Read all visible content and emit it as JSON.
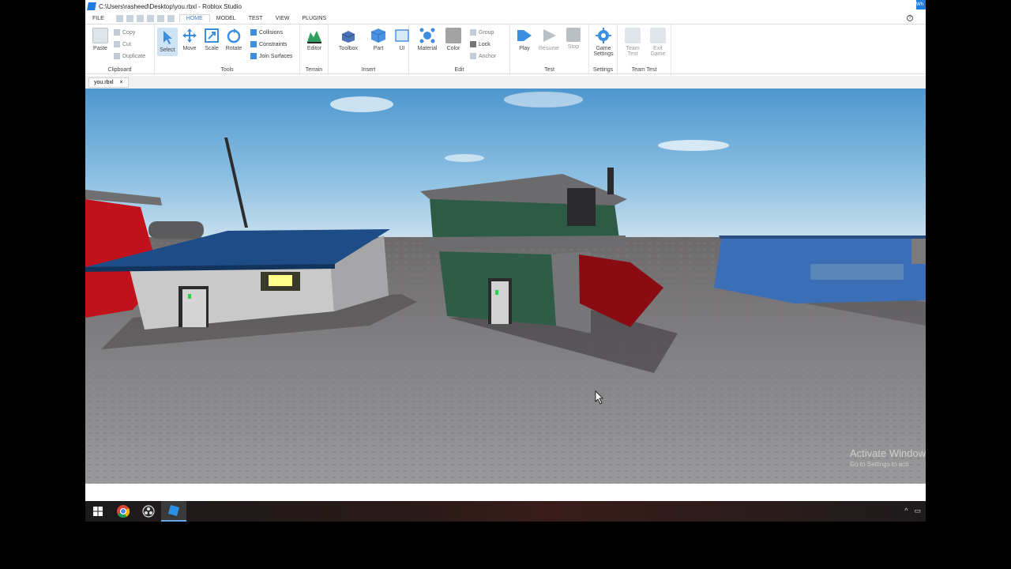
{
  "window": {
    "title": "C:\\Users\\rasheed\\Desktop\\you.rbxl - Roblox Studio",
    "edge_label": "Wh"
  },
  "menu": {
    "file": "FILE",
    "tabs": [
      "HOME",
      "MODEL",
      "TEST",
      "VIEW",
      "PLUGINS"
    ],
    "active_tab": "HOME"
  },
  "ribbon": {
    "clipboard": {
      "paste": "Paste",
      "copy": "Copy",
      "cut": "Cut",
      "duplicate": "Duplicate",
      "label": "Clipboard"
    },
    "tools": {
      "select": "Select",
      "move": "Move",
      "scale": "Scale",
      "rotate": "Rotate",
      "collisions": "Collisions",
      "constraints": "Constraints",
      "join_surfaces": "Join Surfaces",
      "label": "Tools"
    },
    "terrain": {
      "editor": "Editor",
      "label": "Terrain"
    },
    "insert": {
      "toolbox": "Toolbox",
      "part": "Part",
      "ui": "UI",
      "label": "Insert"
    },
    "edit": {
      "material": "Material",
      "color": "Color",
      "group": "Group",
      "lock": "Lock",
      "anchor": "Anchor",
      "label": "Edit"
    },
    "test": {
      "play": "Play",
      "resume": "Resume",
      "stop": "Stop",
      "label": "Test"
    },
    "settings": {
      "game_settings_1": "Game",
      "game_settings_2": "Settings",
      "label": "Settings"
    },
    "team_test": {
      "team_test_1": "Team",
      "team_test_2": "Test",
      "exit_game_1": "Exit",
      "exit_game_2": "Game",
      "label": "Team Test"
    }
  },
  "document": {
    "tab": "you.rbxl",
    "close": "×"
  },
  "watermark": {
    "title": "Activate Window",
    "sub": "Go to Settings to acti"
  },
  "colors": {
    "accent": "#3b82c4",
    "sky": "#7fb3d9",
    "baseplate": "#8a8a8c"
  }
}
